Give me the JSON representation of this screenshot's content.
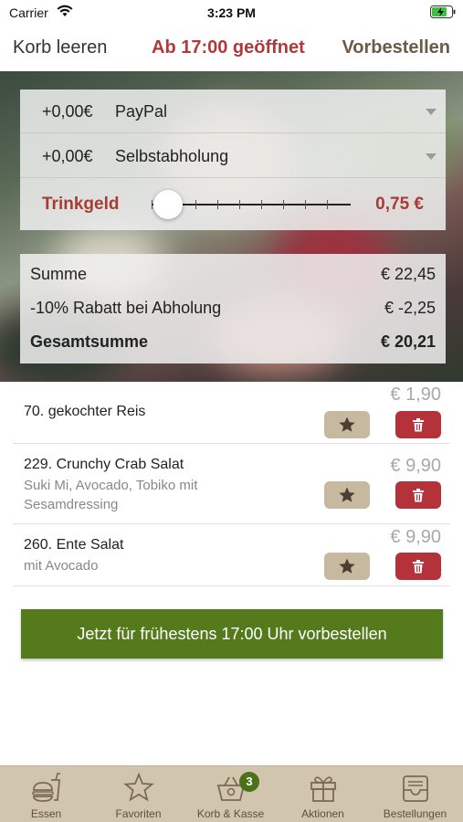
{
  "status_bar": {
    "carrier": "Carrier",
    "time": "3:23 PM"
  },
  "nav": {
    "left": "Korb leeren",
    "title": "Ab 17:00 geöffnet",
    "right": "Vorbestellen"
  },
  "options": {
    "payment": {
      "price": "+0,00€",
      "label": "PayPal"
    },
    "delivery": {
      "price": "+0,00€",
      "label": "Selbstabholung"
    },
    "tip": {
      "label": "Trinkgeld",
      "value": "0,75 €",
      "slider_fraction": 0.0
    }
  },
  "summary": {
    "subtotal_label": "Summe",
    "subtotal_value": "€ 22,45",
    "discount_label": "-10% Rabatt bei Abholung",
    "discount_value": "€ -2,25",
    "total_label": "Gesamtsumme",
    "total_value": "€ 20,21"
  },
  "items": [
    {
      "name": "70. gekochter Reis",
      "desc_1": "",
      "desc_2": "",
      "price": "€ 1,90"
    },
    {
      "name": "229. Crunchy Crab Salat",
      "desc_1": "Suki Mi, Avocado, Tobiko mit",
      "desc_2": "Sesamdressing",
      "price": "€ 9,90"
    },
    {
      "name": "260. Ente Salat",
      "desc_1": "mit Avocado",
      "desc_2": "",
      "price": "€ 9,90"
    }
  ],
  "cta_label": "Jetzt für frühestens 17:00 Uhr vorbestellen",
  "tabs": [
    {
      "label": "Essen",
      "icon": "burger-drink-icon"
    },
    {
      "label": "Favoriten",
      "icon": "star-icon"
    },
    {
      "label": "Korb & Kasse",
      "icon": "basket-icon",
      "badge": "3"
    },
    {
      "label": "Aktionen",
      "icon": "gift-icon"
    },
    {
      "label": "Bestellungen",
      "icon": "tray-icon"
    }
  ],
  "colors": {
    "accent_red": "#b03a3a",
    "brand_green": "#557a1c",
    "tabbar": "#d2c5ae",
    "star_button": "#c7b8a0",
    "delete_button": "#b5323a"
  }
}
